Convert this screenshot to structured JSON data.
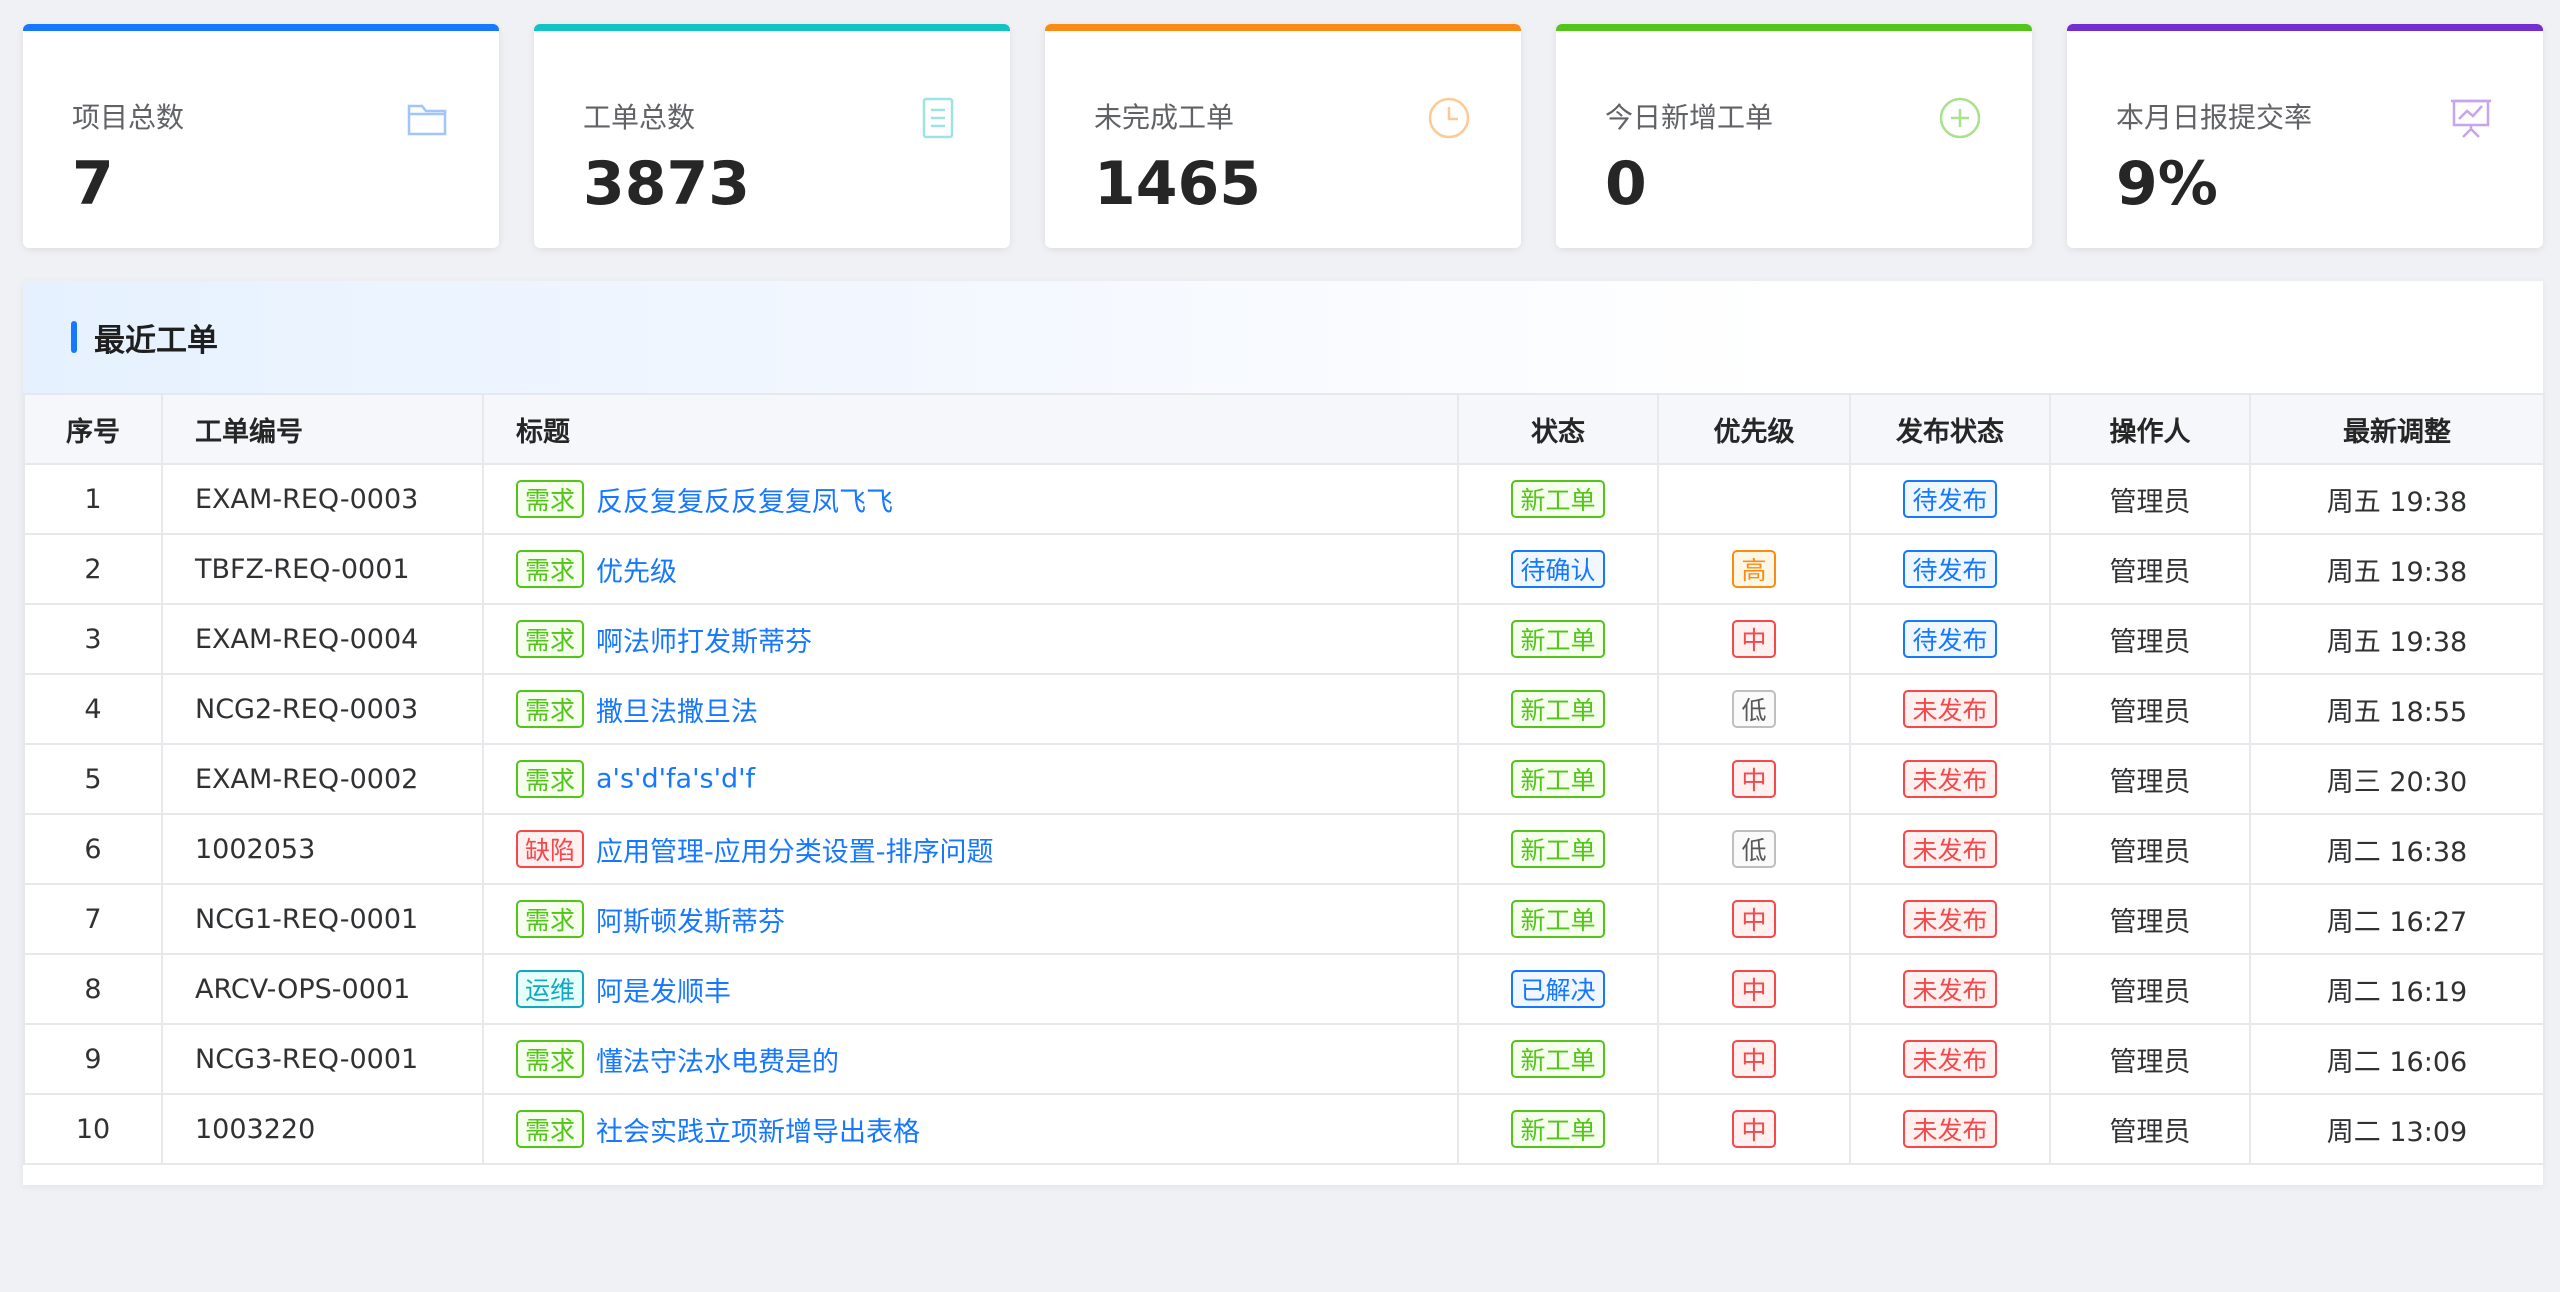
{
  "stats": [
    {
      "label": "项目总数",
      "value": "7",
      "color": "#1677ff",
      "icon": "folder-icon"
    },
    {
      "label": "工单总数",
      "value": "3873",
      "color": "#13c2c2",
      "icon": "document-icon"
    },
    {
      "label": "未完成工单",
      "value": "1465",
      "color": "#fa8c16",
      "icon": "clock-icon"
    },
    {
      "label": "今日新增工单",
      "value": "0",
      "color": "#52c41a",
      "icon": "plus-circle-icon"
    },
    {
      "label": "本月日报提交率",
      "value": "9%",
      "color": "#722ed1",
      "icon": "presentation-chart-icon"
    }
  ],
  "panel": {
    "title": "最近工单"
  },
  "table": {
    "headers": [
      "序号",
      "工单编号",
      "标题",
      "状态",
      "优先级",
      "发布状态",
      "操作人",
      "最新调整"
    ],
    "rows": [
      {
        "no": "1",
        "code": "EXAM-REQ-0003",
        "type": "需求",
        "type_color": "green",
        "title": "反反复复反反复复凤飞飞",
        "status": "新工单",
        "status_color": "green",
        "priority": "",
        "priority_color": "",
        "publish": "待发布",
        "publish_color": "blue",
        "operator": "管理员",
        "updated": "周五 19:38"
      },
      {
        "no": "2",
        "code": "TBFZ-REQ-0001",
        "type": "需求",
        "type_color": "green",
        "title": "优先级",
        "status": "待确认",
        "status_color": "blue",
        "priority": "高",
        "priority_color": "orange",
        "publish": "待发布",
        "publish_color": "blue",
        "operator": "管理员",
        "updated": "周五 19:38"
      },
      {
        "no": "3",
        "code": "EXAM-REQ-0004",
        "type": "需求",
        "type_color": "green",
        "title": "啊法师打发斯蒂芬",
        "status": "新工单",
        "status_color": "green",
        "priority": "中",
        "priority_color": "red",
        "publish": "待发布",
        "publish_color": "blue",
        "operator": "管理员",
        "updated": "周五 19:38"
      },
      {
        "no": "4",
        "code": "NCG2-REQ-0003",
        "type": "需求",
        "type_color": "green",
        "title": "撒旦法撒旦法",
        "status": "新工单",
        "status_color": "green",
        "priority": "低",
        "priority_color": "gray",
        "publish": "未发布",
        "publish_color": "red",
        "operator": "管理员",
        "updated": "周五 18:55"
      },
      {
        "no": "5",
        "code": "EXAM-REQ-0002",
        "type": "需求",
        "type_color": "green",
        "title": "a's'd'fa's'd'f",
        "status": "新工单",
        "status_color": "green",
        "priority": "中",
        "priority_color": "red",
        "publish": "未发布",
        "publish_color": "red",
        "operator": "管理员",
        "updated": "周三 20:30"
      },
      {
        "no": "6",
        "code": "1002053",
        "type": "缺陷",
        "type_color": "red",
        "title": "应用管理-应用分类设置-排序问题",
        "status": "新工单",
        "status_color": "green",
        "priority": "低",
        "priority_color": "gray",
        "publish": "未发布",
        "publish_color": "red",
        "operator": "管理员",
        "updated": "周二 16:38"
      },
      {
        "no": "7",
        "code": "NCG1-REQ-0001",
        "type": "需求",
        "type_color": "green",
        "title": "阿斯顿发斯蒂芬",
        "status": "新工单",
        "status_color": "green",
        "priority": "中",
        "priority_color": "red",
        "publish": "未发布",
        "publish_color": "red",
        "operator": "管理员",
        "updated": "周二 16:27"
      },
      {
        "no": "8",
        "code": "ARCV-OPS-0001",
        "type": "运维",
        "type_color": "cyan",
        "title": "阿是发顺丰",
        "status": "已解决",
        "status_color": "blue",
        "priority": "中",
        "priority_color": "red",
        "publish": "未发布",
        "publish_color": "red",
        "operator": "管理员",
        "updated": "周二 16:19"
      },
      {
        "no": "9",
        "code": "NCG3-REQ-0001",
        "type": "需求",
        "type_color": "green",
        "title": "懂法守法水电费是的",
        "status": "新工单",
        "status_color": "green",
        "priority": "中",
        "priority_color": "red",
        "publish": "未发布",
        "publish_color": "red",
        "operator": "管理员",
        "updated": "周二 16:06"
      },
      {
        "no": "10",
        "code": "1003220",
        "type": "需求",
        "type_color": "green",
        "title": "社会实践立项新增导出表格",
        "status": "新工单",
        "status_color": "green",
        "priority": "中",
        "priority_color": "red",
        "publish": "未发布",
        "publish_color": "red",
        "operator": "管理员",
        "updated": "周二 13:09"
      }
    ]
  }
}
